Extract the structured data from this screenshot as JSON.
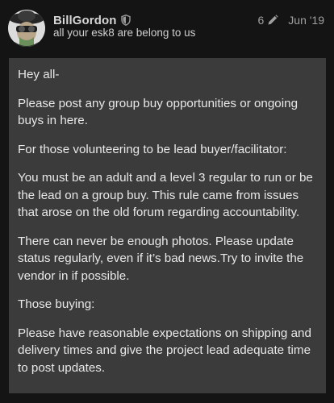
{
  "post": {
    "username": "BillGordon",
    "user_title": "all your esk8 are belong to us",
    "edit_count": "6",
    "date": "Jun '19",
    "paragraphs": [
      "Hey all-",
      "Please post any group buy opportunities or ongoing buys in here.",
      "For those volunteering to be lead buyer/facilitator:",
      "You must be an adult and a level 3 regular to run or be the lead on a group buy. This rule came from issues that arose on the old forum regarding accountability.",
      "There can never be enough photos. Please update status regularly, even if it’s bad news.Try to invite the vendor in if possible.",
      "Those buying:",
      "Please have reasonable expectations on shipping and delivery times and give the project lead adequate time to post updates."
    ]
  },
  "icons": {
    "moderator": "shield-icon",
    "edited": "pencil-icon"
  },
  "colors": {
    "background": "#141414",
    "post_body": "#3b3b3b",
    "text": "#e8e8e8",
    "meta": "#a0a0a0"
  }
}
